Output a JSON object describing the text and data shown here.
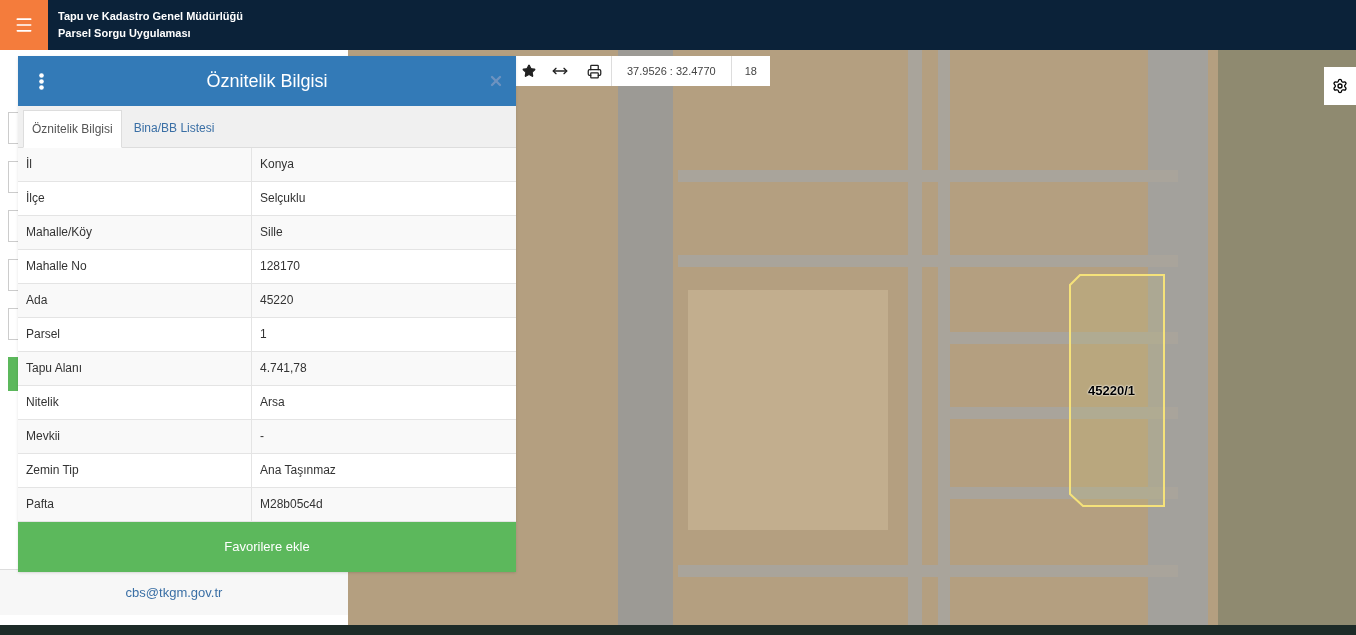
{
  "header": {
    "title": "Tapu ve Kadastro Genel Müdürlüğü",
    "subtitle": "Parsel Sorgu Uygulaması"
  },
  "map_toolbar": {
    "coordinates": "37.9526 : 32.4770",
    "zoom": "18"
  },
  "parcel_label": "45220/1",
  "panel": {
    "title": "Öznitelik Bilgisi",
    "tabs": [
      {
        "label": "Öznitelik Bilgisi",
        "selected": true
      },
      {
        "label": "Bina/BB Listesi",
        "selected": false
      }
    ],
    "rows": [
      {
        "label": "İl",
        "value": "Konya"
      },
      {
        "label": "İlçe",
        "value": "Selçuklu"
      },
      {
        "label": "Mahalle/Köy",
        "value": "Sille"
      },
      {
        "label": "Mahalle No",
        "value": "128170"
      },
      {
        "label": "Ada",
        "value": "45220"
      },
      {
        "label": "Parsel",
        "value": "1"
      },
      {
        "label": "Tapu Alanı",
        "value": "4.741,78"
      },
      {
        "label": "Nitelik",
        "value": "Arsa"
      },
      {
        "label": "Mevkii",
        "value": "-"
      },
      {
        "label": "Zemin Tip",
        "value": "Ana Taşınmaz"
      },
      {
        "label": "Pafta",
        "value": "M28b05c4d"
      }
    ],
    "button": "Favorilere ekle"
  },
  "footer": {
    "email": "cbs@tkgm.gov.tr"
  }
}
